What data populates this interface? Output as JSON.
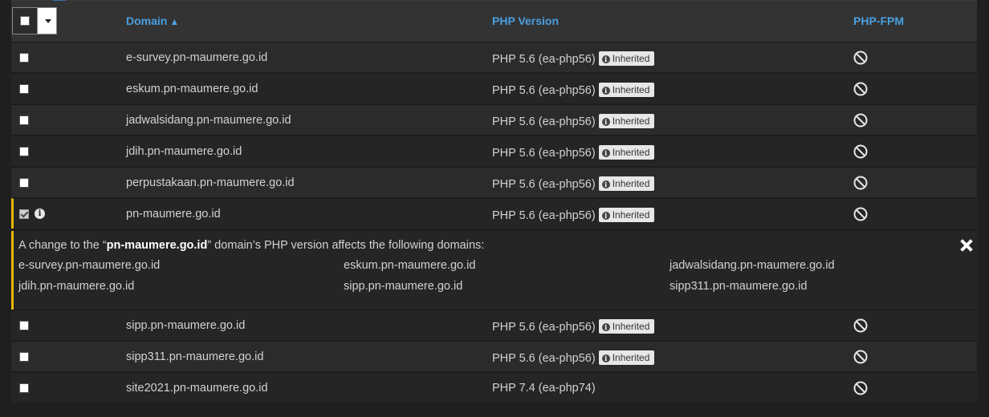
{
  "header": {
    "domain_label": "Domain",
    "domain_sort": "▲",
    "php_label": "PHP Version",
    "fpm_label": "PHP-FPM"
  },
  "rows": [
    {
      "domain": "e-survey.pn-maumere.go.id",
      "php": "PHP 5.6 (ea-php56)",
      "badge": "Inherited",
      "checked": false
    },
    {
      "domain": "eskum.pn-maumere.go.id",
      "php": "PHP 5.6 (ea-php56)",
      "badge": "Inherited",
      "checked": false
    },
    {
      "domain": "jadwalsidang.pn-maumere.go.id",
      "php": "PHP 5.6 (ea-php56)",
      "badge": "Inherited",
      "checked": false
    },
    {
      "domain": "jdih.pn-maumere.go.id",
      "php": "PHP 5.6 (ea-php56)",
      "badge": "Inherited",
      "checked": false
    },
    {
      "domain": "perpustakaan.pn-maumere.go.id",
      "php": "PHP 5.6 (ea-php56)",
      "badge": "Inherited",
      "checked": false
    },
    {
      "domain": "pn-maumere.go.id",
      "php": "PHP 5.6 (ea-php56)",
      "badge": "Inherited",
      "checked": true
    },
    {
      "domain": "sipp.pn-maumere.go.id",
      "php": "PHP 5.6 (ea-php56)",
      "badge": "Inherited",
      "checked": false
    },
    {
      "domain": "sipp311.pn-maumere.go.id",
      "php": "PHP 5.6 (ea-php56)",
      "badge": "Inherited",
      "checked": false
    },
    {
      "domain": "site2021.pn-maumere.go.id",
      "php": "PHP 7.4 (ea-php74)",
      "badge": "",
      "checked": false
    }
  ],
  "notice": {
    "prefix": "A change to the “",
    "domain": "pn-maumere.go.id",
    "suffix": "” domain’s PHP version affects the following domains:",
    "affected": [
      "e-survey.pn-maumere.go.id",
      "eskum.pn-maumere.go.id",
      "jadwalsidang.pn-maumere.go.id",
      "jdih.pn-maumere.go.id",
      "sipp.pn-maumere.go.id",
      "sipp311.pn-maumere.go.id"
    ]
  },
  "icons": {
    "fpm_status": "ban-icon",
    "info": "info-icon",
    "close": "close-icon"
  }
}
